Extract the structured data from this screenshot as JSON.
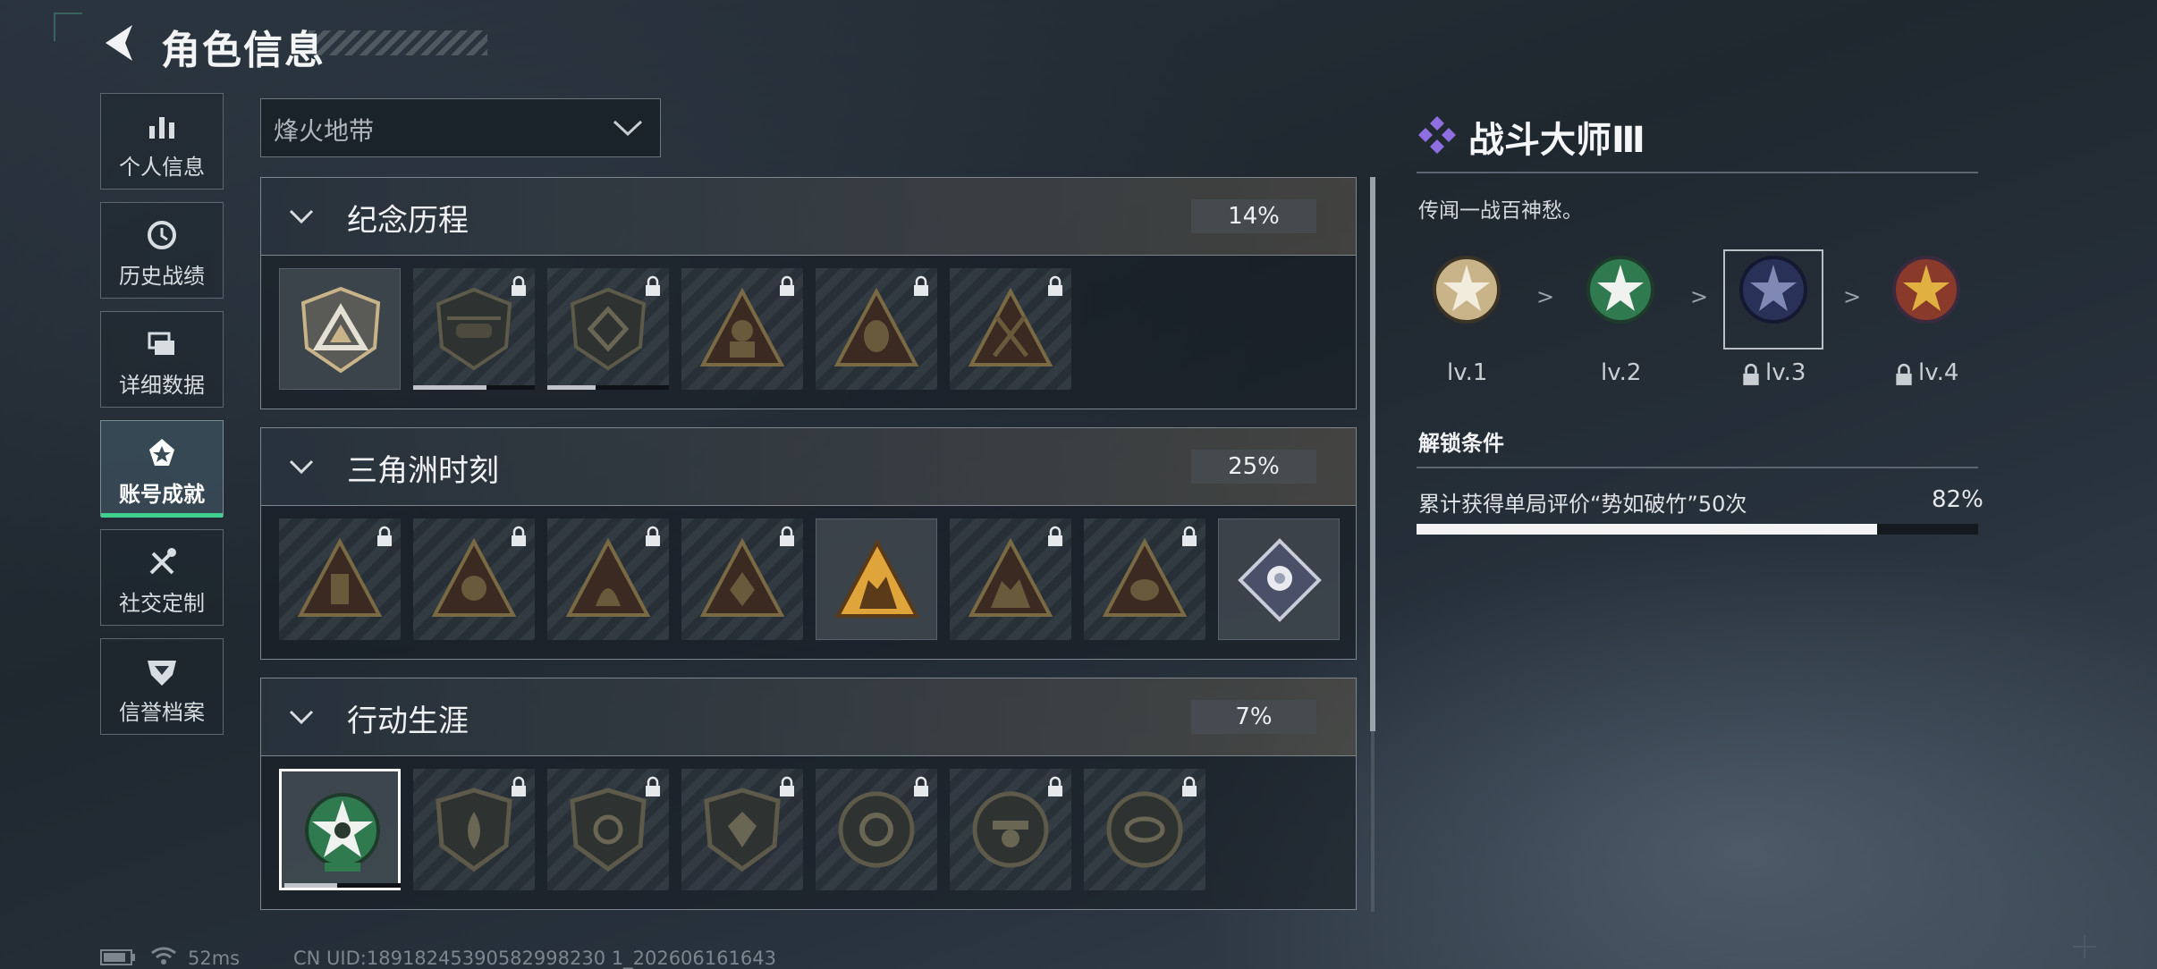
{
  "header": {
    "title": "角色信息"
  },
  "sidebar": {
    "items": [
      {
        "label": "个人信息",
        "icon": "bar-chart-icon"
      },
      {
        "label": "历史战绩",
        "icon": "history-clock-icon"
      },
      {
        "label": "详细数据",
        "icon": "stacked-cards-icon"
      },
      {
        "label": "账号成就",
        "icon": "achievement-star-icon",
        "active": true
      },
      {
        "label": "社交定制",
        "icon": "tools-icon"
      },
      {
        "label": "信誉档案",
        "icon": "shield-chevron-icon"
      }
    ]
  },
  "mode_select": {
    "value": "烽火地带"
  },
  "sections": [
    {
      "name": "纪念历程",
      "percent": "14%",
      "tiles": 6,
      "unlocked_index": 0
    },
    {
      "name": "三角洲时刻",
      "percent": "25%",
      "tiles": 8,
      "unlocked_indexes": [
        4,
        7
      ]
    },
    {
      "name": "行动生涯",
      "percent": "7%",
      "tiles": 7,
      "selected_index": 0
    }
  ],
  "detail": {
    "title": "战斗大师Ⅲ",
    "description": "传闻一战百神愁。",
    "levels": [
      {
        "label": "lv.1",
        "locked": false,
        "color": "#c9b48a"
      },
      {
        "label": "lv.2",
        "locked": false,
        "color": "#2f7a4e"
      },
      {
        "label": "lv.3",
        "locked": true,
        "color": "#2a3158"
      },
      {
        "label": "lv.4",
        "locked": true,
        "color": "#8a3a2a"
      }
    ],
    "unlock_heading": "解锁条件",
    "condition_text": "累计获得单局评价“势如破竹”50次",
    "condition_percent": "82%",
    "condition_progress": 0.82
  },
  "status_bar": {
    "ping": "52ms",
    "uid": "CN UID:18918245390582998230 1_202606161643"
  },
  "colors": {
    "accent_green": "#3fcf8e",
    "diamond_purple": "#8e6ee0"
  }
}
